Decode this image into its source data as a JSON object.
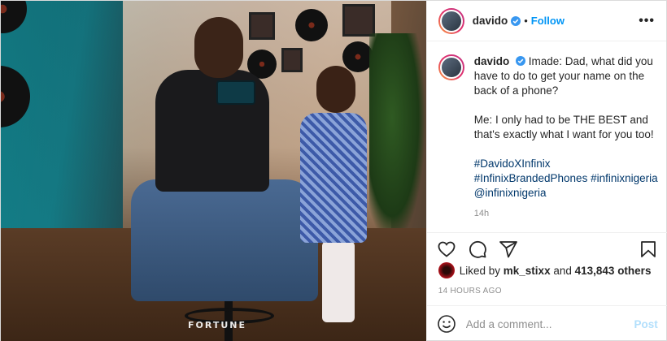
{
  "photo": {
    "alt": "Man and young girl in a studio holding a phone",
    "brand": "FORTUNE"
  },
  "header": {
    "username": "davido",
    "separator": "•",
    "follow_label": "Follow",
    "more_label": "•••"
  },
  "caption": {
    "username": "davido",
    "paragraph1": "Imade: Dad, what did you have to do to get your name on the back of a phone?",
    "paragraph2": "Me: I only had to be THE BEST and that's exactly what I want for you too! ⁡⁡",
    "tags": [
      "#DavidoXInfinix",
      "#InfinixBrandedPhones #infinixnigeria",
      "@infinixnigeria"
    ],
    "age": "14h"
  },
  "likes": {
    "prefix": "Liked by",
    "user": "mk_stixx",
    "and": "and",
    "count": "413,843 others"
  },
  "timestamp": "14 HOURS AGO",
  "comment": {
    "placeholder": "Add a comment...",
    "post_label": "Post"
  },
  "colors": {
    "link": "#0095f6",
    "hashtag": "#00376b",
    "muted": "#8e8e8e",
    "post_disabled": "#b2dffc"
  }
}
